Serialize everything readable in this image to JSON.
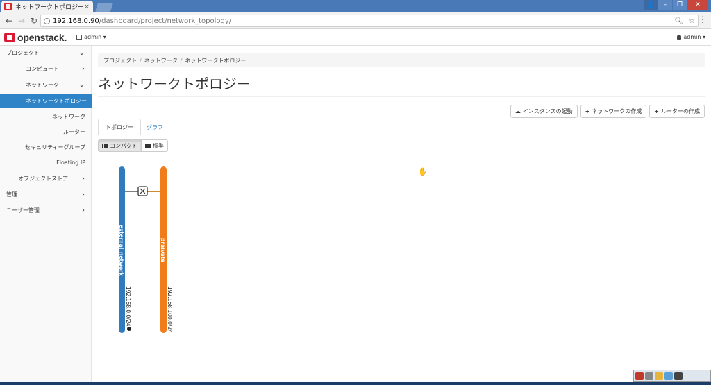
{
  "browser": {
    "tab_title": "ネットワークトポロジー",
    "tab_close": "×",
    "url_host": "192.168.0.90",
    "url_path": "/dashboard/project/network_topology/",
    "win_min": "–",
    "win_max": "❐",
    "win_close": "✕"
  },
  "header": {
    "logo": "openstack.",
    "project": "admin ▾",
    "user": "admin ▾"
  },
  "sidebar": {
    "items": [
      {
        "label": "プロジェクト",
        "chevron": "⌄"
      },
      {
        "label": "コンピュート",
        "chevron": "›"
      },
      {
        "label": "ネットワーク",
        "chevron": "⌄"
      },
      {
        "label": "ネットワークトポロジー"
      },
      {
        "label": "ネットワーク"
      },
      {
        "label": "ルーター"
      },
      {
        "label": "セキュリティーグループ"
      },
      {
        "label": "Floating IP"
      },
      {
        "label": "オブジェクトストア",
        "chevron": "›"
      },
      {
        "label": "管理",
        "chevron": "›"
      },
      {
        "label": "ユーザー管理",
        "chevron": "›"
      }
    ]
  },
  "breadcrumb": [
    "プロジェクト",
    "ネットワーク",
    "ネットワークトポロジー"
  ],
  "page_title": "ネットワークトポロジー",
  "actions": {
    "launch_instance": "インスタンスの起動",
    "create_network": "ネットワークの作成",
    "create_router": "ルーターの作成"
  },
  "tabs": [
    "トポロジー",
    "グラフ"
  ],
  "view": {
    "compact": "コンパクト",
    "normal": "標準"
  },
  "networks": [
    {
      "name": "external_network",
      "cidr": "192.168.0.0/24",
      "color": "#2e7bbd"
    },
    {
      "name": "praivate",
      "cidr": "192.168.100.0/24",
      "color": "#f07d1a"
    }
  ],
  "router_icon": "router-icon"
}
